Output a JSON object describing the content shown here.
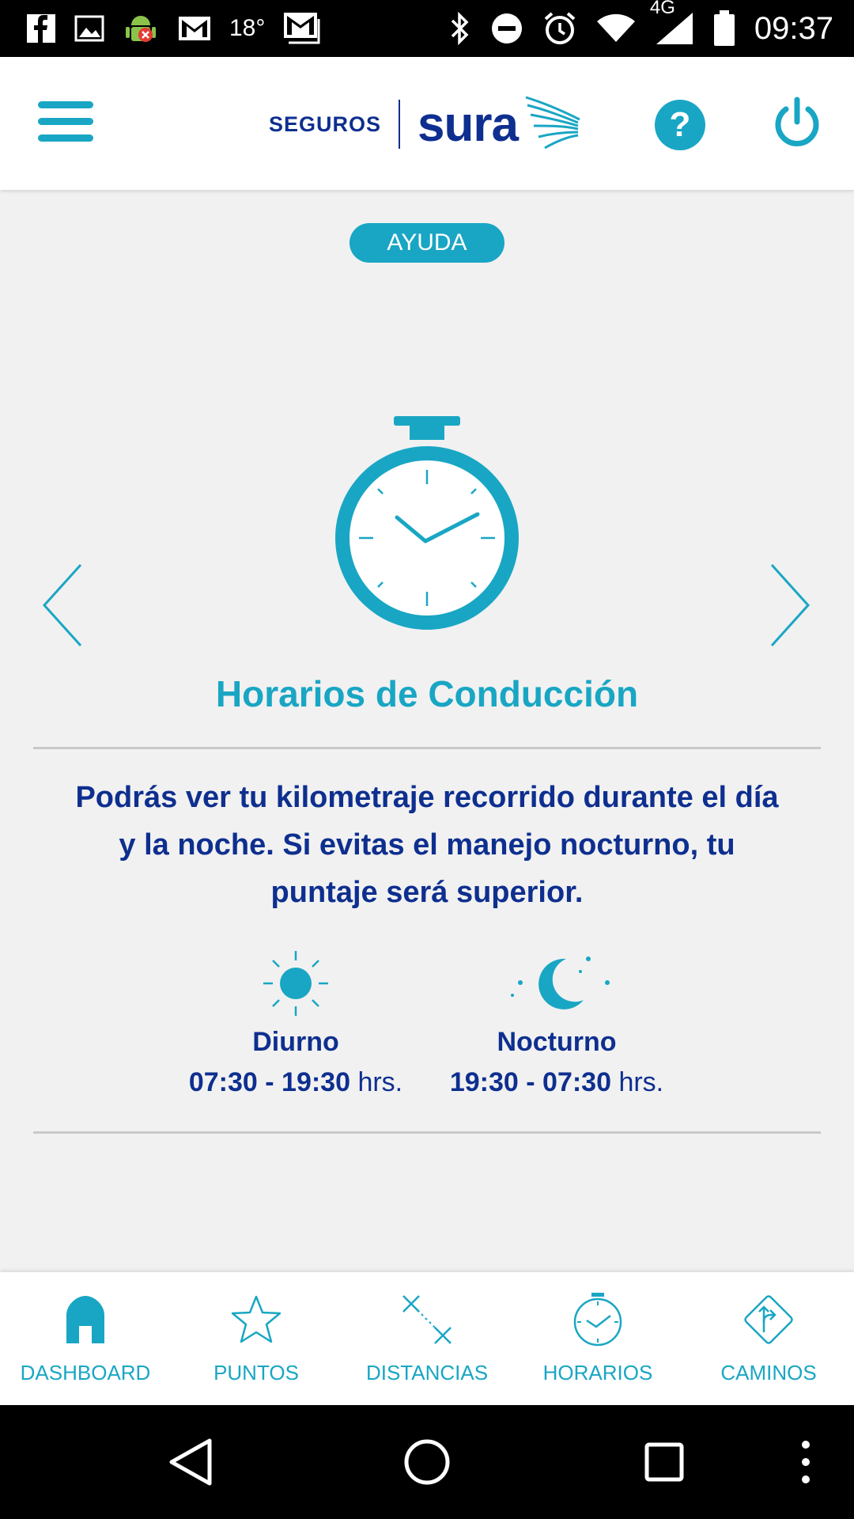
{
  "status_bar": {
    "temperature": "18°",
    "network": "4G",
    "time": "09:37"
  },
  "header": {
    "brand_prefix": "SEGUROS",
    "brand_name": "sura"
  },
  "main": {
    "help_pill": "AYUDA",
    "title": "Horarios de Conducción",
    "description": "Podrás ver tu kilometraje recorrido durante el día y la noche. Si evitas el manejo nocturno, tu puntaje será superior.",
    "shifts": [
      {
        "name": "Diurno",
        "time": "07:30 - 19:30",
        "unit": "hrs."
      },
      {
        "name": "Nocturno",
        "time": "19:30 - 07:30",
        "unit": "hrs."
      }
    ]
  },
  "bottom_nav": {
    "items": [
      {
        "label": "DASHBOARD",
        "icon": "home-icon"
      },
      {
        "label": "PUNTOS",
        "icon": "star-icon"
      },
      {
        "label": "DISTANCIAS",
        "icon": "distance-icon"
      },
      {
        "label": "HORARIOS",
        "icon": "clock-icon"
      },
      {
        "label": "CAMINOS",
        "icon": "route-icon"
      }
    ]
  },
  "colors": {
    "accent": "#19a6c4",
    "brand": "#0e2f8f",
    "background": "#f1f1f1"
  }
}
